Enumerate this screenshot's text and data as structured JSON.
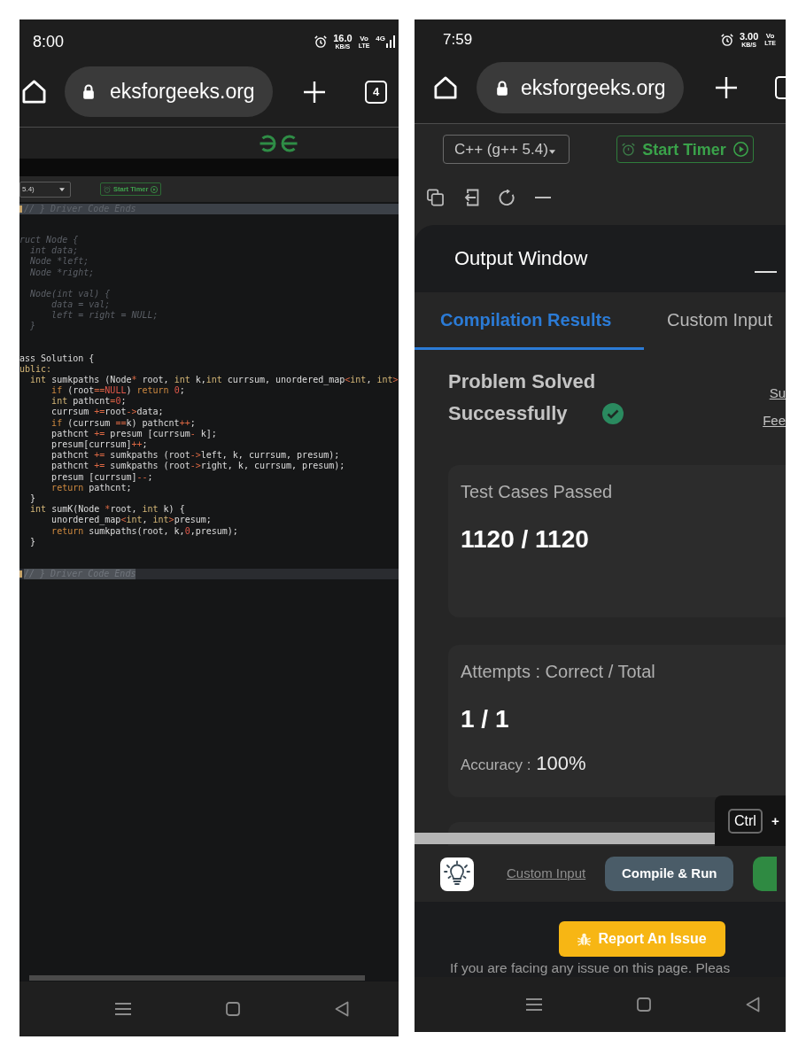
{
  "left_phone": {
    "status_bar": {
      "time": "8:00",
      "speed": "16.0",
      "speed_unit": "KB/S",
      "volte_top": "Vo",
      "volte_bottom": "LTE",
      "network": "4G"
    },
    "browser_bar": {
      "url": "eksforgeeks.org",
      "tab_count": "4"
    },
    "editor_toolbar": {
      "language": "5.4)",
      "timer_button": "Start Timer"
    },
    "editor": {
      "sections": [
        {
          "kind": "marker",
          "text": "// } Driver Code Ends",
          "selected": false
        },
        {
          "kind": "code",
          "lines": [
            {
              "faded": true,
              "text": "ruct Node {"
            },
            {
              "faded": true,
              "text": "  int data;"
            },
            {
              "faded": true,
              "text": "  Node *left;"
            },
            {
              "faded": true,
              "text": "  Node *right;"
            }
          ]
        },
        {
          "kind": "code",
          "lines": [
            {
              "faded": true,
              "text": "  Node(int val) {"
            },
            {
              "faded": true,
              "text": "      data = val;"
            },
            {
              "faded": true,
              "text": "      left = right = NULL;"
            },
            {
              "faded": true,
              "text": "  }"
            }
          ]
        },
        {
          "kind": "code",
          "lines": [
            {
              "faded": false,
              "tokens": [
                {
                  "kind": "plain",
                  "text": "ass Solution {"
                }
              ]
            },
            {
              "faded": false,
              "tokens": [
                {
                  "kind": "type",
                  "text": "ublic:"
                }
              ]
            },
            {
              "faded": false,
              "tokens": [
                {
                  "kind": "type",
                  "text": "  int"
                },
                {
                  "kind": "plain",
                  "text": " sumkpaths (Node"
                },
                {
                  "kind": "operator",
                  "text": "*"
                },
                {
                  "kind": "plain",
                  "text": " root, "
                },
                {
                  "kind": "type",
                  "text": "int"
                },
                {
                  "kind": "plain",
                  "text": " k,"
                },
                {
                  "kind": "type",
                  "text": "int"
                },
                {
                  "kind": "plain",
                  "text": " currsum, unordered_map"
                },
                {
                  "kind": "operator",
                  "text": "<"
                },
                {
                  "kind": "type",
                  "text": "int"
                },
                {
                  "kind": "plain",
                  "text": ", "
                },
                {
                  "kind": "type",
                  "text": "int"
                },
                {
                  "kind": "operator",
                  "text": ">"
                }
              ]
            },
            {
              "faded": false,
              "tokens": [
                {
                  "kind": "keyword",
                  "text": "      if"
                },
                {
                  "kind": "plain",
                  "text": " (root"
                },
                {
                  "kind": "operator",
                  "text": "=="
                },
                {
                  "kind": "literal",
                  "text": "NULL"
                },
                {
                  "kind": "plain",
                  "text": ")"
                },
                {
                  "kind": "keyword",
                  "text": " return"
                },
                {
                  "kind": "literal",
                  "text": " 0"
                },
                {
                  "kind": "plain",
                  "text": ";"
                }
              ]
            },
            {
              "faded": false,
              "tokens": [
                {
                  "kind": "type",
                  "text": "      int"
                },
                {
                  "kind": "plain",
                  "text": " pathcnt"
                },
                {
                  "kind": "operator",
                  "text": "="
                },
                {
                  "kind": "literal",
                  "text": "0"
                },
                {
                  "kind": "plain",
                  "text": ";"
                }
              ]
            },
            {
              "faded": false,
              "tokens": [
                {
                  "kind": "plain",
                  "text": "      currsum "
                },
                {
                  "kind": "operator",
                  "text": "+="
                },
                {
                  "kind": "plain",
                  "text": "root"
                },
                {
                  "kind": "operator",
                  "text": "->"
                },
                {
                  "kind": "plain",
                  "text": "data;"
                }
              ]
            },
            {
              "faded": false,
              "tokens": [
                {
                  "kind": "keyword",
                  "text": "      if"
                },
                {
                  "kind": "plain",
                  "text": " (currsum "
                },
                {
                  "kind": "operator",
                  "text": "=="
                },
                {
                  "kind": "plain",
                  "text": "k) pathcnt"
                },
                {
                  "kind": "operator",
                  "text": "++"
                },
                {
                  "kind": "plain",
                  "text": ";"
                }
              ]
            },
            {
              "faded": false,
              "tokens": [
                {
                  "kind": "plain",
                  "text": "      pathcnt "
                },
                {
                  "kind": "operator",
                  "text": "+="
                },
                {
                  "kind": "plain",
                  "text": " presum [currsum"
                },
                {
                  "kind": "operator",
                  "text": "-"
                },
                {
                  "kind": "plain",
                  "text": " k];"
                }
              ]
            },
            {
              "faded": false,
              "tokens": [
                {
                  "kind": "plain",
                  "text": "      presum[currsum]"
                },
                {
                  "kind": "operator",
                  "text": "++"
                },
                {
                  "kind": "plain",
                  "text": ";"
                }
              ]
            },
            {
              "faded": false,
              "tokens": [
                {
                  "kind": "plain",
                  "text": "      pathcnt "
                },
                {
                  "kind": "operator",
                  "text": "+="
                },
                {
                  "kind": "plain",
                  "text": " sumkpaths (root"
                },
                {
                  "kind": "operator",
                  "text": "->"
                },
                {
                  "kind": "plain",
                  "text": "left, k, currsum, presum);"
                }
              ]
            },
            {
              "faded": false,
              "tokens": [
                {
                  "kind": "plain",
                  "text": "      pathcnt "
                },
                {
                  "kind": "operator",
                  "text": "+="
                },
                {
                  "kind": "plain",
                  "text": " sumkpaths (root"
                },
                {
                  "kind": "operator",
                  "text": "->"
                },
                {
                  "kind": "plain",
                  "text": "right, k, currsum, presum);"
                }
              ]
            },
            {
              "faded": false,
              "tokens": [
                {
                  "kind": "plain",
                  "text": "      presum [currsum]"
                },
                {
                  "kind": "operator",
                  "text": "--"
                },
                {
                  "kind": "plain",
                  "text": ";"
                }
              ]
            },
            {
              "faded": false,
              "tokens": [
                {
                  "kind": "keyword",
                  "text": "      return"
                },
                {
                  "kind": "plain",
                  "text": " pathcnt;"
                }
              ]
            },
            {
              "faded": false,
              "tokens": [
                {
                  "kind": "plain",
                  "text": "  }"
                }
              ]
            },
            {
              "faded": false,
              "tokens": [
                {
                  "kind": "type",
                  "text": "  int"
                },
                {
                  "kind": "plain",
                  "text": " sumK(Node "
                },
                {
                  "kind": "operator",
                  "text": "*"
                },
                {
                  "kind": "plain",
                  "text": "root, "
                },
                {
                  "kind": "type",
                  "text": "int"
                },
                {
                  "kind": "plain",
                  "text": " k) {"
                }
              ]
            },
            {
              "faded": false,
              "tokens": [
                {
                  "kind": "plain",
                  "text": "      unordered_map"
                },
                {
                  "kind": "operator",
                  "text": "<"
                },
                {
                  "kind": "type",
                  "text": "int"
                },
                {
                  "kind": "plain",
                  "text": ", "
                },
                {
                  "kind": "type",
                  "text": "int"
                },
                {
                  "kind": "operator",
                  "text": ">"
                },
                {
                  "kind": "plain",
                  "text": "presum;"
                }
              ]
            },
            {
              "faded": false,
              "tokens": [
                {
                  "kind": "keyword",
                  "text": "      return"
                },
                {
                  "kind": "plain",
                  "text": " sumkpaths(root, k,"
                },
                {
                  "kind": "literal",
                  "text": "0"
                },
                {
                  "kind": "plain",
                  "text": ",presum);"
                }
              ]
            },
            {
              "faded": false,
              "tokens": [
                {
                  "kind": "plain",
                  "text": "  }"
                }
              ]
            }
          ]
        },
        {
          "kind": "marker",
          "text": "// } Driver Code Ends",
          "selected": true
        }
      ]
    }
  },
  "right_phone": {
    "status_bar": {
      "time": "7:59",
      "speed": "3.00",
      "speed_unit": "KB/S",
      "volte_top": "Vo",
      "volte_bottom": "LTE"
    },
    "browser_bar": {
      "url": "eksforgeeks.org"
    },
    "editor_toolbar": {
      "language": "C++ (g++ 5.4)",
      "timer_button": "Start Timer"
    },
    "output_window": {
      "title": "Output Window",
      "tabs": [
        {
          "label": "Compilation Results",
          "selected": true
        },
        {
          "label": "Custom Input",
          "selected": false
        }
      ],
      "result": {
        "message": "Problem Solved Successfully",
        "links": [
          "Su",
          "Fee"
        ]
      },
      "cards": [
        {
          "label": "Test Cases Passed",
          "value": "1120 / 1120"
        },
        {
          "label": "Attempts : Correct / Total",
          "value": "1 / 1",
          "detail_label": "Accuracy :",
          "detail_value": "100%"
        }
      ],
      "shortcut": {
        "key": "Ctrl",
        "plus": "+"
      }
    },
    "action_bar": {
      "link": "Custom Input",
      "compile_button": "Compile & Run"
    },
    "report_button": "Report An Issue",
    "notice": "If you are facing any issue on this page. Pleas"
  }
}
